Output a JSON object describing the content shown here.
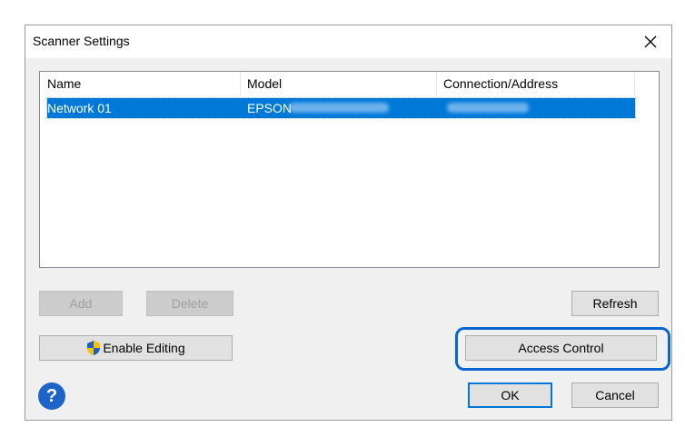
{
  "window": {
    "title": "Scanner Settings"
  },
  "list": {
    "columns": [
      "Name",
      "Model",
      "Connection/Address"
    ],
    "rows": [
      {
        "name": "Network 01",
        "model": "EPSON",
        "address": ""
      }
    ]
  },
  "buttons": {
    "add": "Add",
    "delete": "Delete",
    "refresh": "Refresh",
    "enable_editing": "Enable Editing",
    "access_control": "Access Control",
    "ok": "OK",
    "cancel": "Cancel"
  },
  "icons": {
    "close": "close-icon",
    "shield": "uac-shield-icon",
    "help": "help-icon"
  },
  "colors": {
    "selection": "#0078d7",
    "highlight_ring": "#0a64d2",
    "help": "#1e64c8"
  }
}
